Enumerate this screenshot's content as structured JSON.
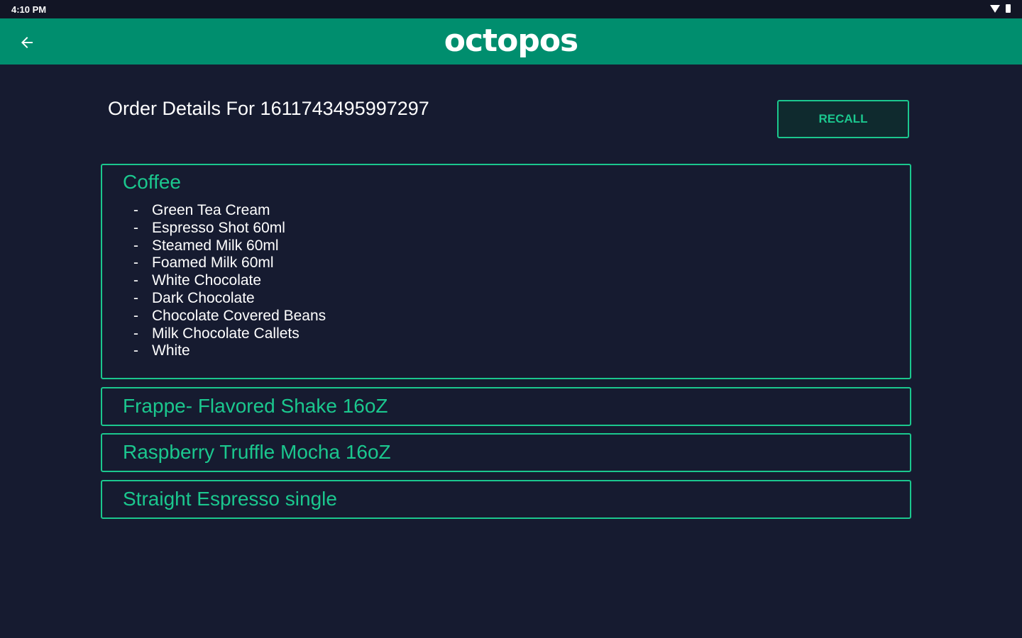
{
  "status_bar": {
    "time": "4:10 PM",
    "icons": [
      "wifi-icon",
      "battery-icon"
    ]
  },
  "app_bar": {
    "back_icon": "arrow-left-icon",
    "logo": "octopos",
    "color": "#008e6e"
  },
  "order": {
    "title": "Order Details For 1611743495997297",
    "recall_label": "RECALL"
  },
  "items": [
    {
      "name": "Coffee",
      "modifiers": [
        "Green Tea Cream",
        "Espresso Shot 60ml",
        "Steamed Milk 60ml",
        "Foamed Milk 60ml",
        "White Chocolate",
        "Dark Chocolate",
        "Chocolate Covered Beans",
        "Milk Chocolate Callets",
        "White"
      ]
    },
    {
      "name": "Frappe- Flavored Shake 16oZ"
    },
    {
      "name": "Raspberry Truffle Mocha 16oZ"
    },
    {
      "name": "Straight Espresso single"
    }
  ],
  "colors": {
    "background": "#161b30",
    "accent": "#1bc78e",
    "header": "#008e6e"
  }
}
